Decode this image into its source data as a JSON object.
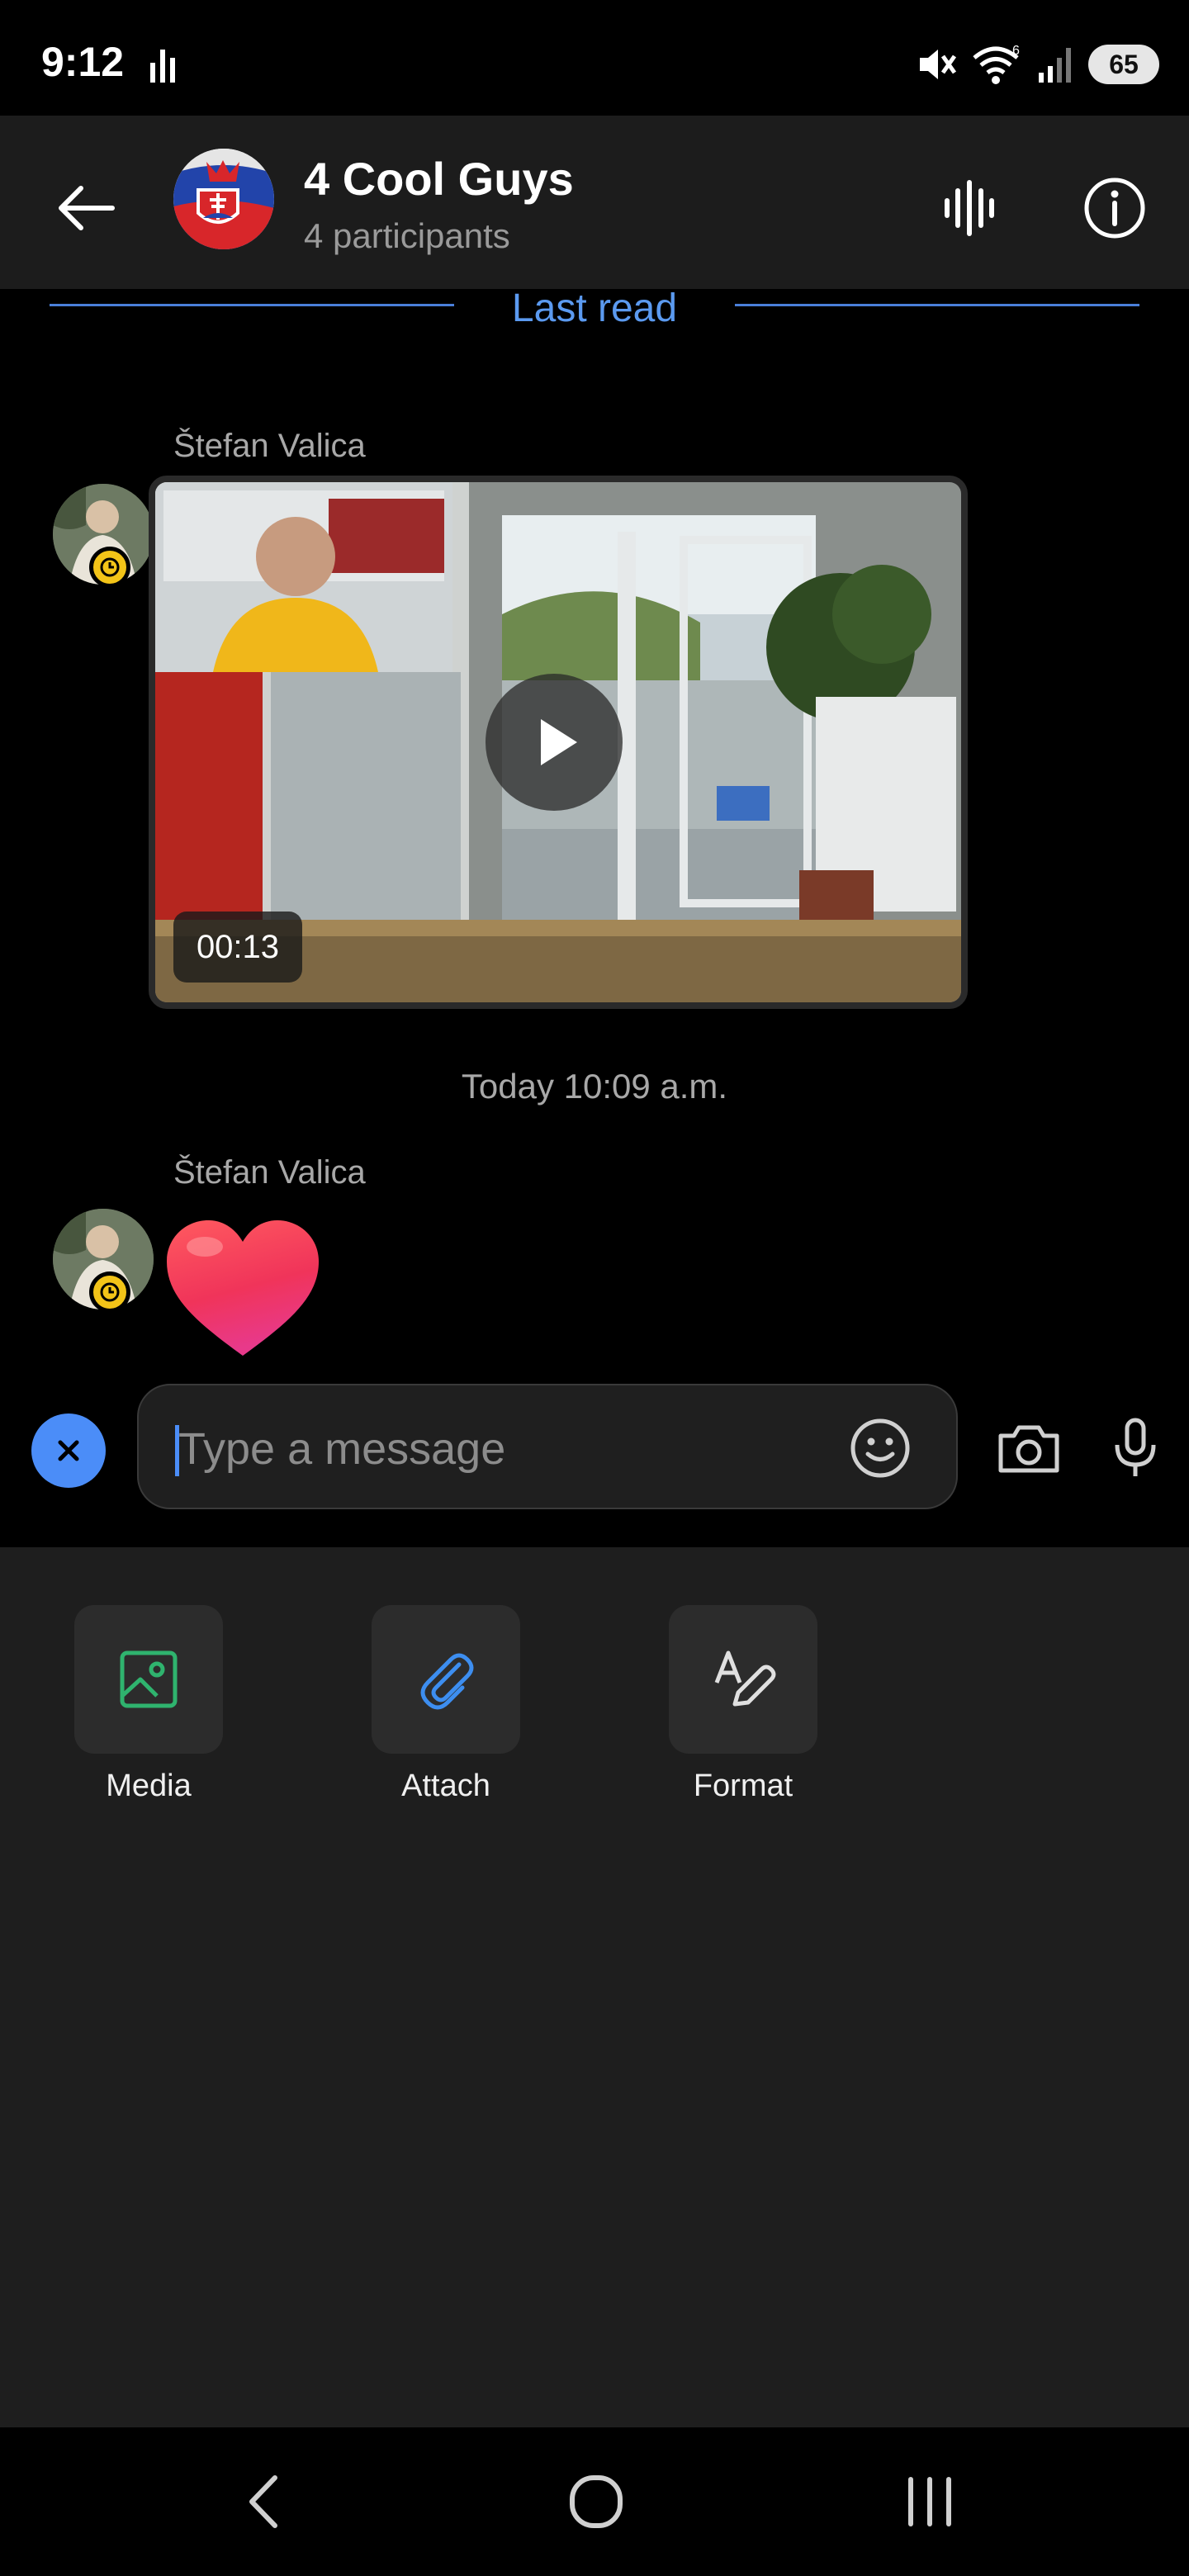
{
  "status_bar": {
    "time": "9:12",
    "battery": "65",
    "wifi_label": "6"
  },
  "header": {
    "title": "4 Cool Guys",
    "subtitle": "4 participants"
  },
  "conversation": {
    "last_read_label": "Last read",
    "messages": [
      {
        "sender": "Štefan Valica",
        "type": "video",
        "duration": "00:13"
      },
      {
        "sender": "Štefan Valica",
        "type": "emoji",
        "content": "heart"
      }
    ],
    "timestamp": "Today 10:09 a.m."
  },
  "composer": {
    "placeholder": "Type a message"
  },
  "panel": {
    "items": [
      {
        "label": "Media",
        "icon": "image-icon"
      },
      {
        "label": "Attach",
        "icon": "paperclip-icon"
      },
      {
        "label": "Format",
        "icon": "format-pen-icon"
      }
    ]
  },
  "colors": {
    "accent": "#4b8df8",
    "last_read": "#5b9af0",
    "badge": "#f3c418",
    "media_icon": "#2fb36e",
    "attach_icon": "#3d8ef0"
  }
}
